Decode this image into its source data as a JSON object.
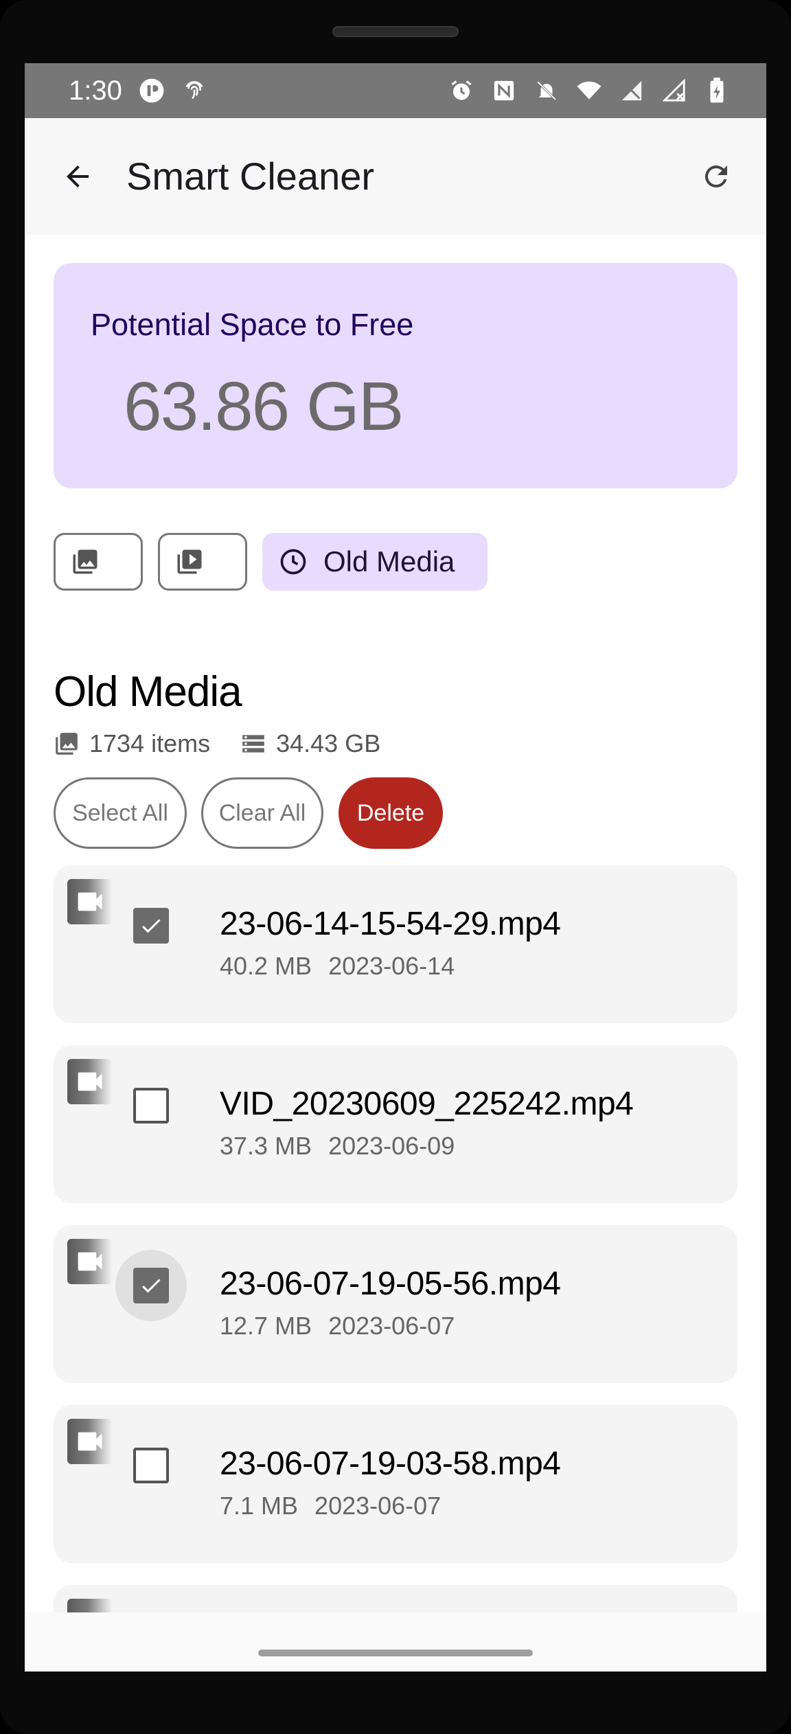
{
  "status_bar": {
    "time": "1:30",
    "left_icons": [
      "app-notification-icon",
      "fingerprint-icon"
    ],
    "right_icons": [
      "alarm-icon",
      "nfc-icon",
      "notifications-off-icon",
      "wifi-icon",
      "no-sim-icon",
      "no-signal-icon",
      "battery-charging-icon"
    ]
  },
  "app_bar": {
    "title": "Smart Cleaner",
    "back_icon": "arrow-back-icon",
    "refresh_icon": "refresh-icon"
  },
  "summary": {
    "label": "Potential Space to Free",
    "value": "63.86 GB"
  },
  "filters": {
    "images_icon": "image-icon",
    "videos_icon": "video-library-icon",
    "old_media_icon": "clock-icon",
    "old_media_label": "Old Media",
    "selected": "old_media"
  },
  "section": {
    "title": "Old Media",
    "items_count": "1734 items",
    "total_size": "34.43 GB"
  },
  "actions": {
    "select_all": "Select All",
    "clear_all": "Clear All",
    "delete": "Delete"
  },
  "files": [
    {
      "name": "23-06-14-15-54-29.mp4",
      "size": "40.2 MB",
      "date": "2023-06-14",
      "checked": true
    },
    {
      "name": "VID_20230609_225242.mp4",
      "size": "37.3 MB",
      "date": "2023-06-09",
      "checked": false
    },
    {
      "name": "23-06-07-19-05-56.mp4",
      "size": "12.7 MB",
      "date": "2023-06-07",
      "checked": true
    },
    {
      "name": "23-06-07-19-03-58.mp4",
      "size": "7.1 MB",
      "date": "2023-06-07",
      "checked": false
    }
  ],
  "colors": {
    "accent_container": "#e8dcfe",
    "delete": "#b3261e",
    "status_bar": "#777777"
  }
}
